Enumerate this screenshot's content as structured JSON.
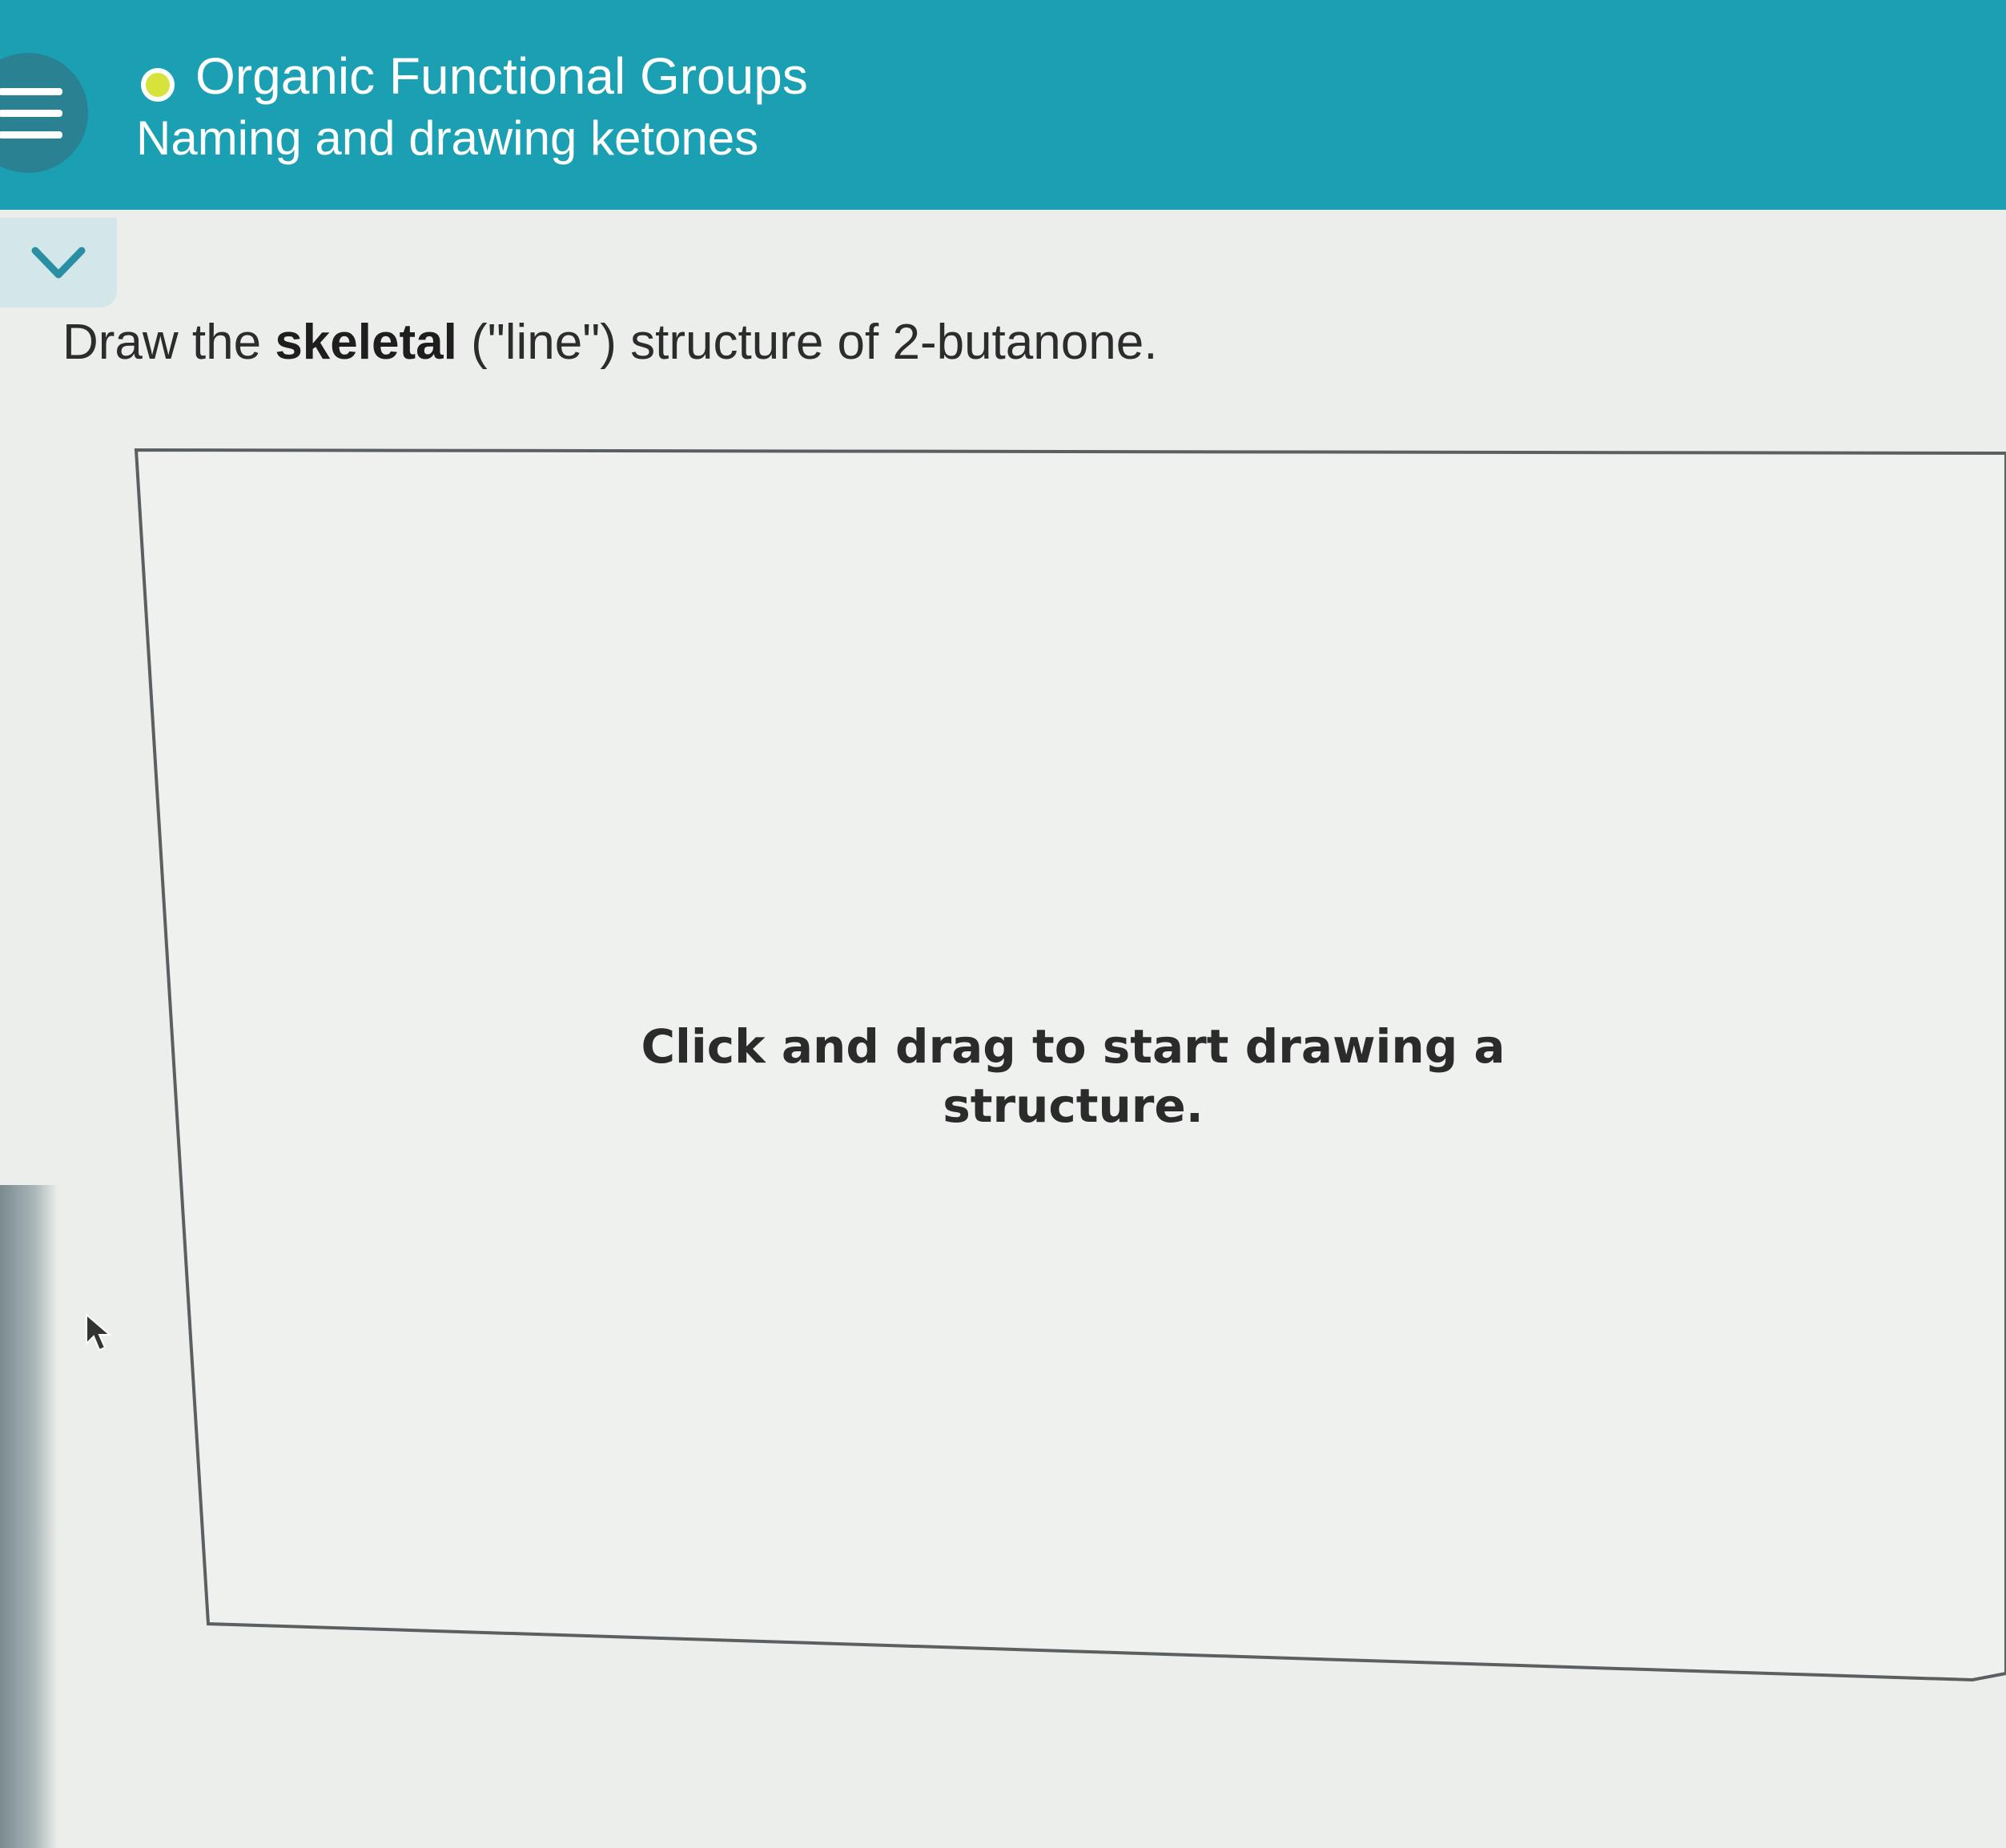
{
  "header": {
    "topic": "Organic Functional Groups",
    "lesson": "Naming and drawing ketones",
    "status_color": "#d7e33a",
    "bar_color": "#1a9fb3",
    "menu_icon": "hamburger-menu-icon"
  },
  "collapse": {
    "icon": "chevron-down-icon"
  },
  "question": {
    "prefix": "Draw the ",
    "bold": "skeletal",
    "suffix": " (\"line\") structure of 2-butanone."
  },
  "drawing_area": {
    "hint": "Click and drag to start drawing a structure."
  }
}
